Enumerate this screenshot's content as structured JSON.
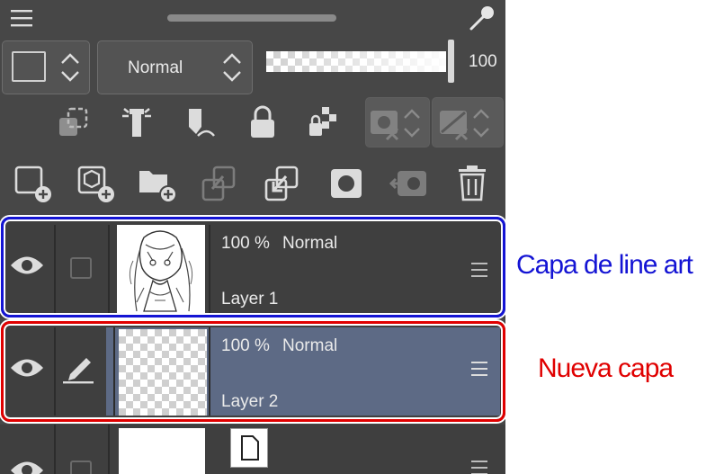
{
  "top_bar": {
    "menu_icon": "hamburger-icon",
    "eyedropper_icon": "eyedropper-icon"
  },
  "controls": {
    "color_icon": "layer-color-square-icon",
    "blend_mode": "Normal",
    "opacity_value": "100",
    "opacity_level_percent": 100
  },
  "toolbar_row1": [
    "clip-to-layer-below-icon",
    "reference-layer-icon",
    "draft-layer-icon",
    "lock-layer-icon",
    "lock-transparent-pixels-icon",
    "mask-icon",
    "ruler-icon"
  ],
  "toolbar_row2": [
    "new-raster-layer-icon",
    "new-vector-layer-icon",
    "new-folder-icon",
    "transfer-to-lower-layer-icon",
    "merge-with-layer-below-icon",
    "create-layer-mask-icon",
    "apply-mask-icon",
    "delete-layer-icon"
  ],
  "layers": [
    {
      "opacity": "100 %",
      "blend": "Normal",
      "name": "Layer 1",
      "thumbnail": "line-art-sketch"
    },
    {
      "opacity": "100 %",
      "blend": "Normal",
      "name": "Layer 2",
      "thumbnail": "transparent"
    },
    {
      "opacity": "",
      "blend": "",
      "name": "",
      "thumbnail": "white-paper"
    }
  ],
  "annotations": {
    "line_art": "Capa de line art",
    "line_art_color": "#1414d4",
    "new_layer": "Nueva capa",
    "new_layer_color": "#e00000"
  },
  "colors": {
    "panel_bg": "#474747",
    "selected_row": "#5d6a85",
    "blue_outline": "#1414d4",
    "red_outline": "#e00000"
  }
}
